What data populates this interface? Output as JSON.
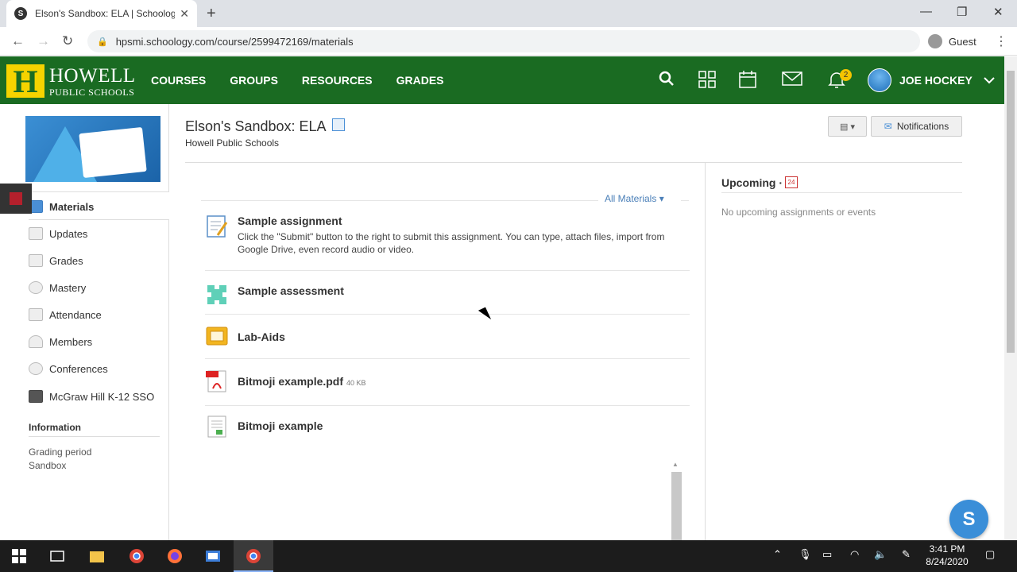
{
  "browser": {
    "tab_title": "Elson's Sandbox: ELA | Schoology",
    "tab_favicon": "S",
    "url": "hpsmi.schoology.com/course/2599472169/materials",
    "profile": "Guest"
  },
  "header": {
    "logo_line1": "HOWELL",
    "logo_line2": "PUBLIC SCHOOLS",
    "logo_letter": "H",
    "nav": [
      "COURSES",
      "GROUPS",
      "RESOURCES",
      "GRADES"
    ],
    "notification_count": "2",
    "user_name": "JOE HOCKEY",
    "colors": {
      "bar": "#1a6b22",
      "logo": "#f5d300"
    }
  },
  "sidebar": {
    "items": [
      {
        "label": "Materials",
        "icon": "materials-icon"
      },
      {
        "label": "Updates",
        "icon": "updates-icon"
      },
      {
        "label": "Grades",
        "icon": "grades-icon"
      },
      {
        "label": "Mastery",
        "icon": "mastery-icon"
      },
      {
        "label": "Attendance",
        "icon": "attendance-icon"
      },
      {
        "label": "Members",
        "icon": "members-icon"
      },
      {
        "label": "Conferences",
        "icon": "conferences-icon"
      },
      {
        "label": "McGraw Hill K-12 SSO",
        "icon": "mcgraw-hill-icon"
      }
    ],
    "info_heading": "Information",
    "grading_period_label": "Grading period",
    "grading_period_value": "Sandbox"
  },
  "course": {
    "title": "Elson's Sandbox: ELA",
    "subtitle": "Howell Public Schools",
    "notifications_button": "Notifications"
  },
  "materials": {
    "filter_label": "All Materials",
    "items": [
      {
        "name": "Sample assignment",
        "description": "Click the \"Submit\" button to the right to submit this assignment. You can type, attach files, import from Google Drive, even record audio or video.",
        "icon": "assignment-icon"
      },
      {
        "name": "Sample assessment",
        "icon": "assessment-icon"
      },
      {
        "name": "Lab-Aids",
        "icon": "folder-icon"
      },
      {
        "name": "Bitmoji example.pdf",
        "size": "40 KB",
        "icon": "pdf-icon"
      },
      {
        "name": "Bitmoji example",
        "icon": "page-icon"
      }
    ]
  },
  "upcoming": {
    "title": "Upcoming",
    "calendar_day": "24",
    "empty_text": "No upcoming assignments or events"
  },
  "fab_label": "S",
  "taskbar": {
    "time": "3:41 PM",
    "date": "8/24/2020"
  }
}
